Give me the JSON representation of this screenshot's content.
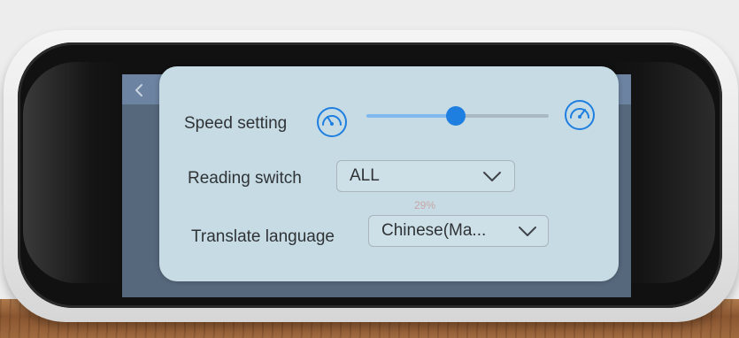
{
  "dialog": {
    "speed_setting_label": "Speed setting",
    "speed_level_percent": 49,
    "reading_switch_label": "Reading switch",
    "reading_switch_value": "ALL",
    "translate_language_label": "Translate language",
    "translate_language_value": "Chinese(Ma...",
    "percent_text": "29%"
  },
  "icons": {
    "back": "chevron-left-icon",
    "speed_slow": "gauge-slow-icon",
    "speed_fast": "gauge-fast-icon",
    "dropdown": "chevron-down-icon"
  },
  "colors": {
    "dialog_bg": "#c6dbe4",
    "accent": "#1e7fe0",
    "accent_light": "#7fb9f0"
  }
}
